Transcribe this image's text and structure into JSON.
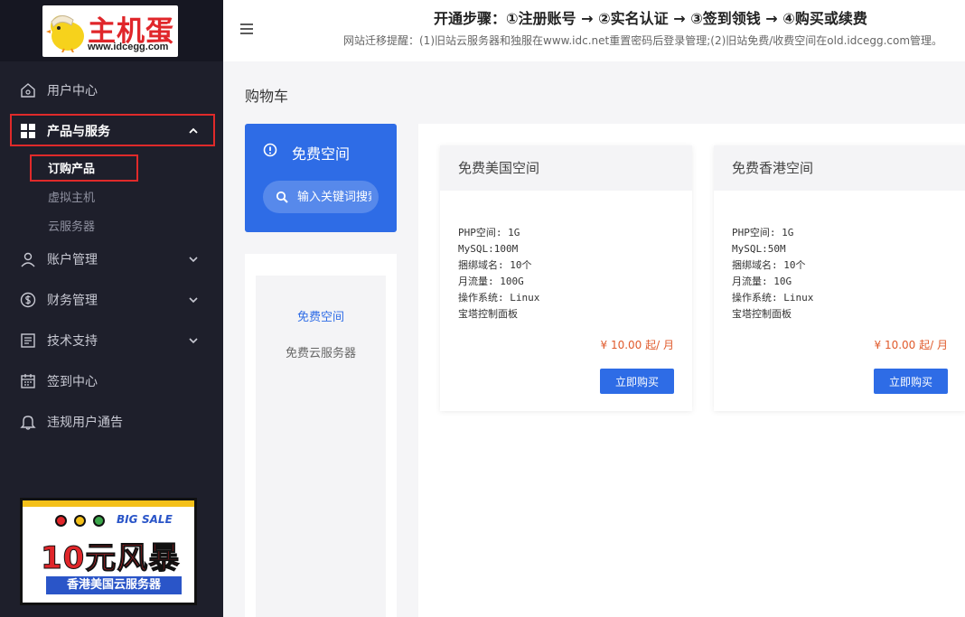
{
  "brand": {
    "name": "主机蛋",
    "url": "www.idcegg.com"
  },
  "topbar": {
    "steps": "开通步骤：①注册账号 → ②实名认证 → ③签到领钱 → ④购买或续费",
    "notice": "网站迁移提醒：(1)旧站云服务器和独服在www.idc.net重置密码后登录管理;(2)旧站免费/收费空间在old.idcegg.com管理。"
  },
  "sidebar": {
    "items": [
      {
        "label": "用户中心"
      },
      {
        "label": "产品与服务"
      },
      {
        "label": "账户管理"
      },
      {
        "label": "财务管理"
      },
      {
        "label": "技术支持"
      },
      {
        "label": "签到中心"
      },
      {
        "label": "违规用户通告"
      }
    ],
    "subitems": [
      {
        "label": "订购产品"
      },
      {
        "label": "虚拟主机"
      },
      {
        "label": "云服务器"
      }
    ]
  },
  "promo": {
    "big": "BIG",
    "sale": "SALE",
    "title": "10元风暴",
    "subtitle": "香港美国云服务器"
  },
  "page": {
    "title": "购物车"
  },
  "category": {
    "label": "免费空间",
    "search_placeholder": "输入关键词搜索"
  },
  "menu": {
    "items": [
      {
        "label": "免费空间"
      },
      {
        "label": "免费云服务器"
      }
    ]
  },
  "products": [
    {
      "name": "免费美国空间",
      "specs": [
        "PHP空间: 1G",
        "MySQL:100M",
        "捆绑域名: 10个",
        "月流量: 100G",
        "操作系统: Linux",
        "宝塔控制面板"
      ],
      "price": "¥ 10.00 起/ 月",
      "buy_label": "立即购买"
    },
    {
      "name": "免费香港空间",
      "specs": [
        "PHP空间: 1G",
        "MySQL:50M",
        "捆绑域名: 10个",
        "月流量: 10G",
        "操作系统: Linux",
        "宝塔控制面板"
      ],
      "price": "¥ 10.00 起/ 月",
      "buy_label": "立即购买"
    }
  ],
  "colors": {
    "sidebar_bg": "#1e1f2b",
    "accent": "#2e6ce6",
    "price": "#e05a2b",
    "highlight_box": "#e02a2a"
  }
}
